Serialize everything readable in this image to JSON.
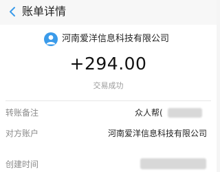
{
  "header": {
    "title": "账单详情"
  },
  "payer": {
    "name": "河南爱洋信息科技有限公司",
    "avatar_icon": "user-avatar-icon",
    "avatar_color": "#3a9bea"
  },
  "transaction": {
    "amount": "+294.00",
    "status": "交易成功"
  },
  "details": [
    {
      "label": "转账备注",
      "value": "众人帮("
    },
    {
      "label": "对方账户",
      "value": "河南爱洋信息科技有限公司"
    },
    {
      "label": "创建时间",
      "value": ""
    }
  ]
}
